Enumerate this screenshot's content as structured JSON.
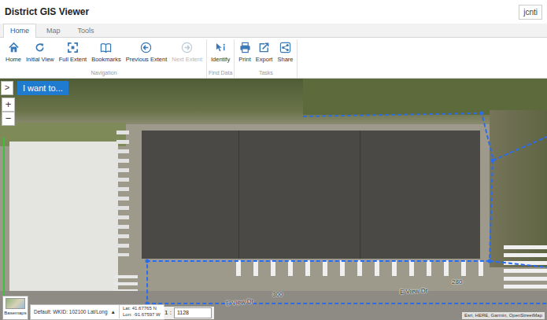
{
  "window": {
    "title": "District GIS Viewer",
    "user": "jcnti"
  },
  "tabs": [
    {
      "label": "Home",
      "selected": true
    },
    {
      "label": "Map",
      "selected": false
    },
    {
      "label": "Tools",
      "selected": false
    }
  ],
  "ribbon": {
    "groups": [
      {
        "label": "Navigation",
        "buttons": [
          {
            "label": "Home",
            "disabled": false
          },
          {
            "label": "Initial View",
            "disabled": false
          },
          {
            "label": "Full Extent",
            "disabled": false
          },
          {
            "label": "Bookmarks",
            "disabled": false
          },
          {
            "label": "Previous Extent",
            "disabled": false
          },
          {
            "label": "Next Extent",
            "disabled": true
          }
        ]
      },
      {
        "label": "Find Data",
        "buttons": [
          {
            "label": "Identify",
            "disabled": false
          }
        ]
      },
      {
        "label": "Tasks",
        "buttons": [
          {
            "label": "Print",
            "disabled": false
          },
          {
            "label": "Export",
            "disabled": false
          },
          {
            "label": "Share",
            "disabled": false
          }
        ]
      }
    ]
  },
  "map": {
    "panel_toggle": ">",
    "i_want_to": "I want to...",
    "zoom_in": "+",
    "zoom_out": "−",
    "labels": [
      {
        "text": "E View Dr"
      },
      {
        "text": "E View Dr"
      },
      {
        "text": "280"
      },
      {
        "text": "300"
      }
    ],
    "basemaps": "Basemaps",
    "coordinates": {
      "system": "Default: WKID: 102100 Lat/Long",
      "toggle": "▲",
      "lat": "Lat: 41.67765 N",
      "lon": "Lon: -91.67597 W"
    },
    "scale": {
      "prefix": "1 :",
      "value": "1128"
    },
    "attribution": "Esri, HERE, Garmin, OpenStreetMap"
  }
}
